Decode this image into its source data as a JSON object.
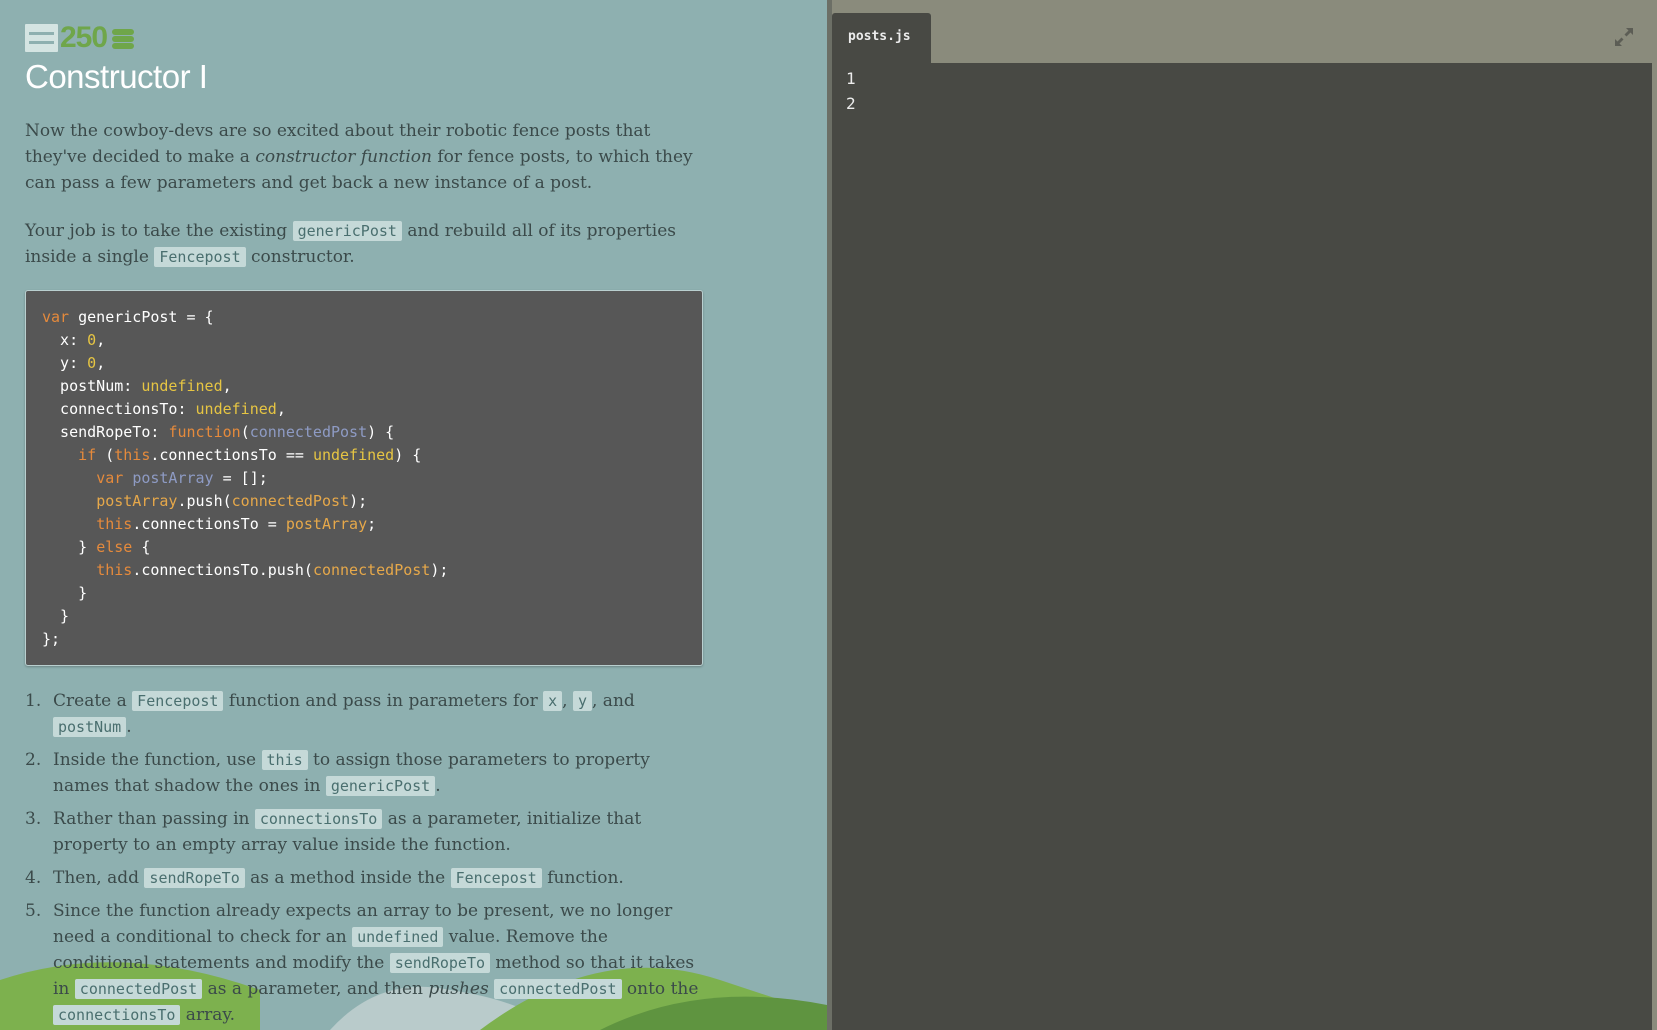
{
  "badge": {
    "points": "250"
  },
  "title": "Constructor I",
  "intro": {
    "p1_a": "Now the cowboy-devs are so excited about their robotic fence posts that they've decided to make a ",
    "p1_em": "constructor function",
    "p1_b": " for fence posts, to which they can pass a few parameters and get back a new instance of a post.",
    "p2_a": "Your job is to take the existing ",
    "p2_code1": "genericPost",
    "p2_b": " and rebuild all of its properties inside a single ",
    "p2_code2": "Fencepost",
    "p2_c": " constructor."
  },
  "code_lines": [
    [
      [
        "kw",
        "var"
      ],
      [
        "plain",
        " genericPost = {"
      ]
    ],
    [
      [
        "plain",
        "  x: "
      ],
      [
        "num",
        "0"
      ],
      [
        "plain",
        ","
      ]
    ],
    [
      [
        "plain",
        "  y: "
      ],
      [
        "num",
        "0"
      ],
      [
        "plain",
        ","
      ]
    ],
    [
      [
        "plain",
        "  postNum: "
      ],
      [
        "num",
        "undefined"
      ],
      [
        "plain",
        ","
      ]
    ],
    [
      [
        "plain",
        "  connectionsTo: "
      ],
      [
        "num",
        "undefined"
      ],
      [
        "plain",
        ","
      ]
    ],
    [
      [
        "plain",
        "  sendRopeTo: "
      ],
      [
        "kw",
        "function"
      ],
      [
        "plain",
        "("
      ],
      [
        "param",
        "connectedPost"
      ],
      [
        "plain",
        ") {"
      ]
    ],
    [
      [
        "plain",
        "    "
      ],
      [
        "kw",
        "if"
      ],
      [
        "plain",
        " ("
      ],
      [
        "kw",
        "this"
      ],
      [
        "plain",
        ".connectionsTo == "
      ],
      [
        "num",
        "undefined"
      ],
      [
        "plain",
        ") {"
      ]
    ],
    [
      [
        "plain",
        "      "
      ],
      [
        "kw",
        "var"
      ],
      [
        "plain",
        " "
      ],
      [
        "param",
        "postArray"
      ],
      [
        "plain",
        " = [];"
      ]
    ],
    [
      [
        "plain",
        "      "
      ],
      [
        "arg",
        "postArray"
      ],
      [
        "plain",
        ".push("
      ],
      [
        "arg",
        "connectedPost"
      ],
      [
        "plain",
        ");"
      ]
    ],
    [
      [
        "plain",
        "      "
      ],
      [
        "kw",
        "this"
      ],
      [
        "plain",
        ".connectionsTo = "
      ],
      [
        "arg",
        "postArray"
      ],
      [
        "plain",
        ";"
      ]
    ],
    [
      [
        "plain",
        "    } "
      ],
      [
        "kw",
        "else"
      ],
      [
        "plain",
        " {"
      ]
    ],
    [
      [
        "plain",
        "      "
      ],
      [
        "kw",
        "this"
      ],
      [
        "plain",
        ".connectionsTo.push("
      ],
      [
        "arg",
        "connectedPost"
      ],
      [
        "plain",
        ");"
      ]
    ],
    [
      [
        "plain",
        "    }"
      ]
    ],
    [
      [
        "plain",
        "  }"
      ]
    ],
    [
      [
        "plain",
        "};"
      ]
    ]
  ],
  "steps": [
    {
      "num": "1.",
      "parts": [
        [
          "t",
          "Create a "
        ],
        [
          "c",
          "Fencepost"
        ],
        [
          "t",
          " function and pass in parameters for "
        ],
        [
          "c",
          "x"
        ],
        [
          "t",
          ", "
        ],
        [
          "c",
          "y"
        ],
        [
          "t",
          ", and "
        ],
        [
          "c",
          "postNum"
        ],
        [
          "t",
          "."
        ]
      ]
    },
    {
      "num": "2.",
      "parts": [
        [
          "t",
          "Inside the function, use "
        ],
        [
          "c",
          "this"
        ],
        [
          "t",
          " to assign those parameters to property names that shadow the ones in "
        ],
        [
          "c",
          "genericPost"
        ],
        [
          "t",
          "."
        ]
      ]
    },
    {
      "num": "3.",
      "parts": [
        [
          "t",
          "Rather than passing in "
        ],
        [
          "c",
          "connectionsTo"
        ],
        [
          "t",
          " as a parameter, initialize that property to an empty array value inside the function."
        ]
      ]
    },
    {
      "num": "4.",
      "parts": [
        [
          "t",
          "Then, add "
        ],
        [
          "c",
          "sendRopeTo"
        ],
        [
          "t",
          " as a method inside the "
        ],
        [
          "c",
          "Fencepost"
        ],
        [
          "t",
          " function."
        ]
      ]
    },
    {
      "num": "5.",
      "parts": [
        [
          "t",
          "Since the function already expects an array to be present, we no longer need a conditional to check for an "
        ],
        [
          "c",
          "undefined"
        ],
        [
          "t",
          " value. Remove the conditional statements and modify the "
        ],
        [
          "c",
          "sendRopeTo"
        ],
        [
          "t",
          " method so that it takes in "
        ],
        [
          "c",
          "connectedPost"
        ],
        [
          "t",
          " as a parameter, and then "
        ],
        [
          "e",
          "pushes"
        ],
        [
          "t",
          " "
        ],
        [
          "c",
          "connectedPost"
        ],
        [
          "t",
          " onto the "
        ],
        [
          "c",
          "connectionsTo"
        ],
        [
          "t",
          " array."
        ]
      ]
    }
  ],
  "editor": {
    "tab_label": "posts.js",
    "line_numbers": [
      "1",
      "2"
    ]
  },
  "colors": {
    "accent_green": "#6fa64a",
    "left_bg": "#8eb0b0",
    "editor_bg": "#484944",
    "keyword": "#e58a3c",
    "literal": "#e6c543",
    "param": "#8e9bc4"
  },
  "icons": [
    "menu-icon",
    "coin-stack-icon",
    "expand-icon"
  ]
}
